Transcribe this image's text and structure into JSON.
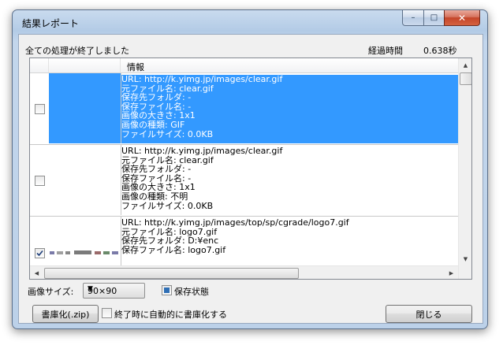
{
  "window": {
    "title": "結果レポート",
    "controls": {
      "minimize": "–",
      "maximize": "□",
      "close": "✕"
    }
  },
  "status": {
    "message": "全ての処理が終了しました",
    "elapsed_label": "経過時間",
    "elapsed_value": "0.638秒"
  },
  "list": {
    "header": {
      "info": "情報"
    },
    "rows": [
      {
        "checked": false,
        "selected": true,
        "info": "URL: http://k.yimg.jp/images/clear.gif\n元ファイル名: clear.gif\n保存先フォルダ: -\n保存ファイル名: -\n画像の大きさ: 1x1\n画像の種類: GIF\nファイルサイズ: 0.0KB"
      },
      {
        "checked": false,
        "selected": false,
        "info": "URL: http://k.yimg.jp/images/clear.gif\n元ファイル名: clear.gif\n保存先フォルダ: -\n保存ファイル名: -\n画像の大きさ: 1x1\n画像の種類: 不明\nファイルサイズ: 0.0KB"
      },
      {
        "checked": true,
        "selected": false,
        "info": "URL: http://k.yimg.jp/images/top/sp/cgrade/logo7.gif\n元ファイル名: logo7.gif\n保存先フォルダ: D:¥enc\n保存ファイル名: logo7.gif"
      }
    ],
    "scroll": {
      "up": "▲",
      "down": "▼",
      "left": "◀",
      "right": "▶"
    }
  },
  "options": {
    "size_label": "画像サイズ:",
    "size_value": "90×90",
    "size_dropdown_icon": "▼",
    "save_state_label": "保存状態",
    "save_state_checked": true
  },
  "footer": {
    "zip_button": "書庫化(.zip)",
    "auto_zip_label": "終了時に自動的に書庫化する",
    "auto_zip_checked": false,
    "close_button": "閉じる"
  }
}
